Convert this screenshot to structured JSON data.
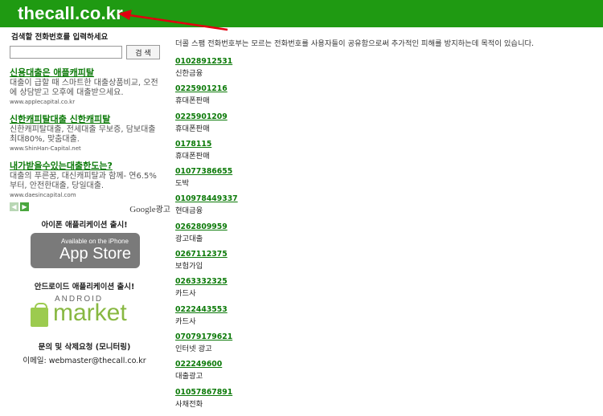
{
  "header": {
    "logo_text": "thecall.co.kr",
    "bar_color": "#1f9a12",
    "arrow_color": "#e1000f"
  },
  "search": {
    "label": "검색할 전화번호를 입력하세요",
    "input_value": "",
    "button_label": "검 색"
  },
  "ads": [
    {
      "title": "신용대출은 애플캐피탈",
      "text": "대출이 급할 때 스마트한 대출상품비교, 오전에 상담받고 오후에 대출받으세요.",
      "url": "www.applecapital.co.kr"
    },
    {
      "title": "신한캐피탈대출 신한캐피탈",
      "text": "신한캐피탈대출, 전세대출 무보증, 담보대출최대80%, 맞춤대출.",
      "url": "www.ShinHan-Capital.net"
    },
    {
      "title": "내가받을수있는대출한도는?",
      "text": "대출의 푸른꿈, 대신캐피탈과 함께- 연6.5%부터, 안전한대출, 당일대출.",
      "url": "www.daesincapital.com"
    }
  ],
  "ad_nav": {
    "prev_icon": "chevron-left-icon",
    "next_icon": "chevron-right-icon",
    "google_word": "Google",
    "google_suffix": "광고"
  },
  "promos": {
    "iphone_title": "아이폰 애플리케이션 출시!",
    "appstore_line1": "Available on the iPhone",
    "appstore_line2": "App Store",
    "android_title": "안드로이드 애플리케이션 출시!",
    "android_word": "ANDROID",
    "market_word": "market"
  },
  "contact": {
    "title": "문의 및 삭제요청 (모니터링)",
    "email": "이메일: webmaster@thecall.co.kr"
  },
  "main": {
    "description": "더콜 스팸 전화번호부는 모르는 전화번호를 사용자들이 공유함으로써 추가적인 피해를 방지하는데 목적이 있습니다.",
    "entries": [
      {
        "number": "01028912531",
        "category": "신한금융"
      },
      {
        "number": "0225901216",
        "category": "휴대폰판매"
      },
      {
        "number": "0225901209",
        "category": "휴대폰판매"
      },
      {
        "number": "0178115",
        "category": "휴대폰판매"
      },
      {
        "number": "01077386655",
        "category": "도박"
      },
      {
        "number": "010978449337",
        "category": "현대금융"
      },
      {
        "number": "0262809959",
        "category": "광고대출"
      },
      {
        "number": "0267112375",
        "category": "보험가입"
      },
      {
        "number": "0263332325",
        "category": "카드사"
      },
      {
        "number": "0222443553",
        "category": "카드사"
      },
      {
        "number": "07079179621",
        "category": "인터넷 광고"
      },
      {
        "number": "022249600",
        "category": "대출광고"
      },
      {
        "number": "01057867891",
        "category": "사채전화"
      }
    ]
  }
}
